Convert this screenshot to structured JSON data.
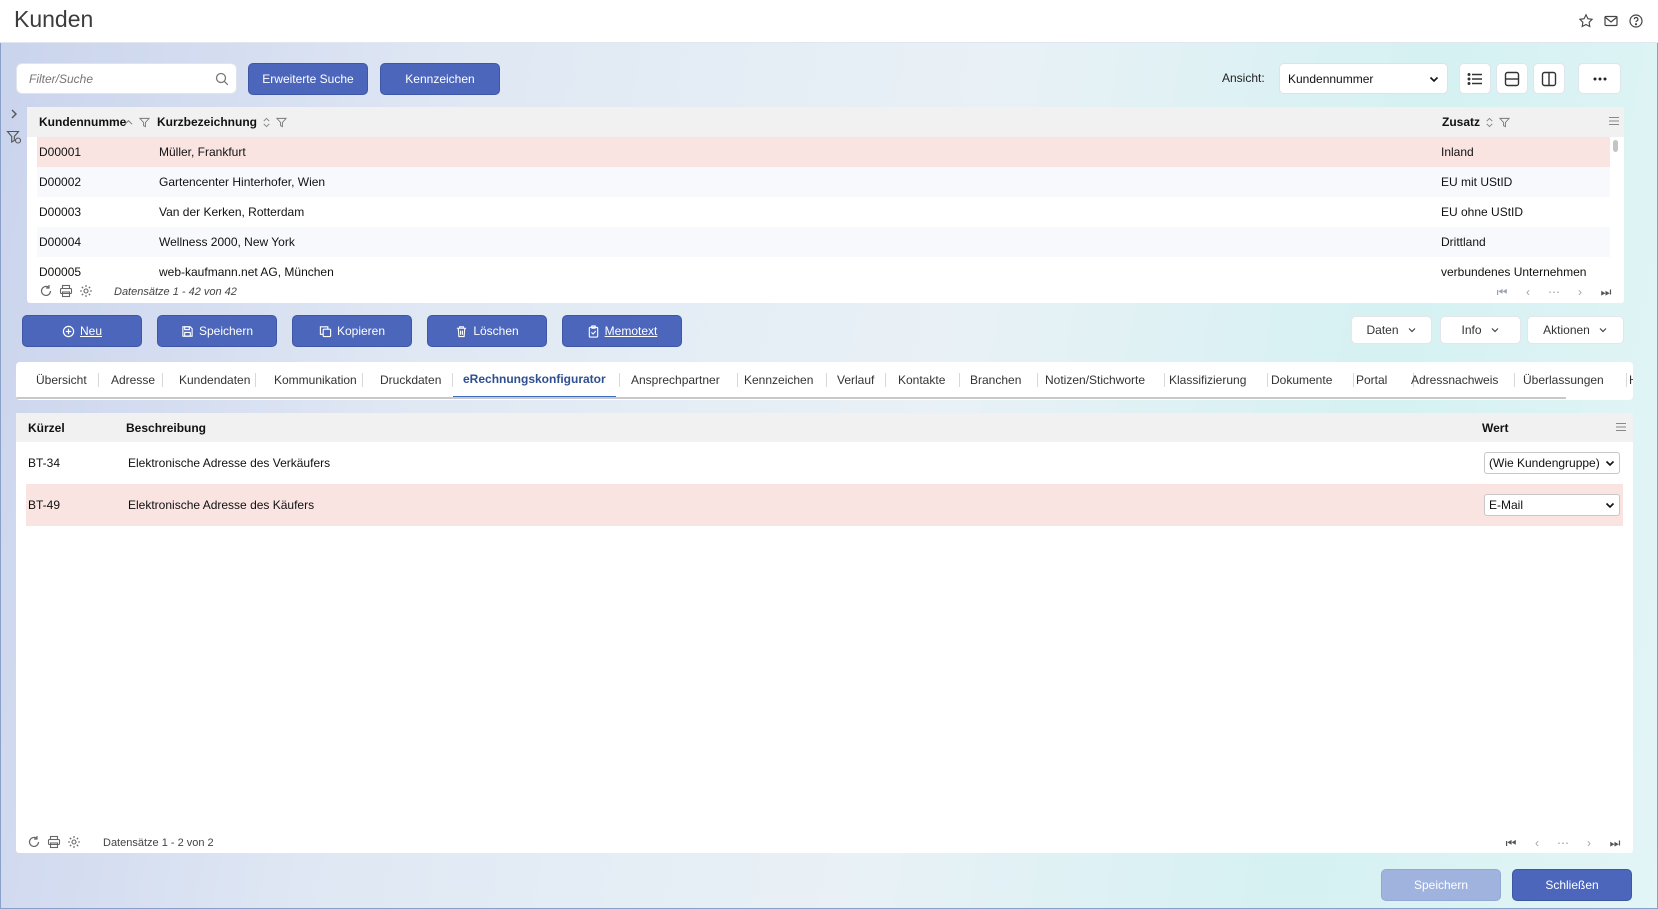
{
  "window": {
    "title": "Kunden"
  },
  "toolbar": {
    "search_placeholder": "Filter/Suche",
    "advanced_search": "Erweiterte Suche",
    "tags": "Kennzeichen",
    "view_label": "Ansicht:",
    "view_value": "Kundennummer"
  },
  "customers": {
    "columns": [
      "Kundennumme",
      "Kurzbezeichnung",
      "Zusatz"
    ],
    "rows": [
      {
        "nr": "D00001",
        "name": "Müller, Frankfurt",
        "zusatz": "Inland"
      },
      {
        "nr": "D00002",
        "name": "Gartencenter Hinterhofer, Wien",
        "zusatz": "EU mit UStID"
      },
      {
        "nr": "D00003",
        "name": "Van der Kerken, Rotterdam",
        "zusatz": "EU ohne UStID"
      },
      {
        "nr": "D00004",
        "name": "Wellness 2000, New York",
        "zusatz": "Drittland"
      },
      {
        "nr": "D00005",
        "name": "web-kaufmann.net AG, München",
        "zusatz": "verbundenes Unternehmen"
      }
    ],
    "record_count": "Datensätze 1 - 42 von 42"
  },
  "actions": {
    "new": "Neu",
    "save": "Speichern",
    "copy": "Kopieren",
    "delete": "Löschen",
    "memo": "Memotext",
    "data": "Daten",
    "info": "Info",
    "actions": "Aktionen"
  },
  "tabs": [
    "Übersicht",
    "Adresse",
    "Kundendaten",
    "Kommunikation",
    "Druckdaten",
    "eRechnungskonfigurator",
    "Ansprechpartner",
    "Kennzeichen",
    "Verlauf",
    "Kontakte",
    "Branchen",
    "Notizen/Stichworte",
    "Klassifizierung",
    "Dokumente",
    "Portal",
    "Adressnachweis",
    "Überlassungen",
    "H"
  ],
  "einvoice": {
    "columns": [
      "Kürzel",
      "Beschreibung",
      "Wert"
    ],
    "rows": [
      {
        "code": "BT-34",
        "desc": "Elektronische Adresse des Verkäufers",
        "value": "(Wie Kundengruppe)"
      },
      {
        "code": "BT-49",
        "desc": "Elektronische Adresse des Käufers",
        "value": "E-Mail"
      }
    ],
    "record_count": "Datensätze 1 - 2 von 2"
  },
  "footer": {
    "save": "Speichern",
    "close": "Schließen"
  },
  "colors": {
    "primary": "#4b66bb",
    "selected_row": "#f9e4e2",
    "active_tab": "#2f4f8f"
  }
}
